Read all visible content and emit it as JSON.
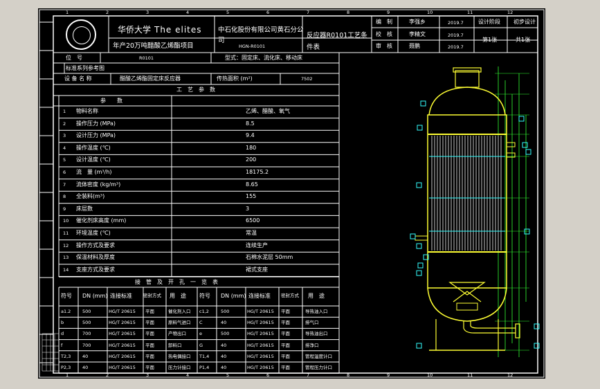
{
  "title_block": {
    "university_cn": "华侨大学",
    "university_en": "The elites",
    "project": "年产20万吨醋酸乙烯酯项目",
    "company_line1": "中石化股份有限公司黄石分公",
    "company_line2": "司",
    "drawing_no": "HGN-R0101",
    "drawing_title_line1": "反应器R0101工艺条",
    "drawing_title_line2": "件表",
    "roles": [
      "编　制",
      "校　核",
      "审　核"
    ],
    "names": [
      "李强乡",
      "李精文",
      "聂鹏"
    ],
    "dates": [
      "2019.7",
      "2019.7",
      "2019.7"
    ],
    "design_stage_label": "设计阶段",
    "design_stage_value": "初步设计",
    "sheet_no": "第1张",
    "sheet_total": "共1张"
  },
  "info_rows": {
    "tag_label": "位　号",
    "tag_value": "R0101",
    "type_label": "型式：固定床、流化床、移动床",
    "std_label": "标准系列参考图",
    "name_label": "设 备 名 称",
    "name_value": "醋酸乙烯酯固定床反应器",
    "area_label": "传热面积 (m²)",
    "area_value": "7502"
  },
  "process_table": {
    "title": "工　艺　参　数",
    "header": "参　　数",
    "rows": [
      {
        "no": "1",
        "param": "物料名称",
        "value": "乙烯、醋酸、氧气"
      },
      {
        "no": "2",
        "param": "操作压力 (MPa)",
        "value": "8.5"
      },
      {
        "no": "3",
        "param": "设计压力 (MPa)",
        "value": "9.4"
      },
      {
        "no": "4",
        "param": "操作温度 (℃)",
        "value": "180"
      },
      {
        "no": "5",
        "param": "设计温度 (℃)",
        "value": "200"
      },
      {
        "no": "6",
        "param": "流　量 (m³/h)",
        "value": "18175.2"
      },
      {
        "no": "7",
        "param": "流体密度 (kg/m³)",
        "value": "8.65"
      },
      {
        "no": "8",
        "param": "全装料(m³)",
        "value": "155"
      },
      {
        "no": "9",
        "param": "床层数",
        "value": "3"
      },
      {
        "no": "10",
        "param": "催化剂床高度 (mm)",
        "value": "6500"
      },
      {
        "no": "11",
        "param": "环境温度 (℃)",
        "value": "常温"
      },
      {
        "no": "12",
        "param": "操作方式及要求",
        "value": "连续生产"
      },
      {
        "no": "13",
        "param": "保温材料及厚度",
        "value": "石棉水泥层 50mm"
      },
      {
        "no": "14",
        "param": "支座方式及要求",
        "value": "裙式支座"
      }
    ]
  },
  "nozzle_table": {
    "title": "接　管　及　开　孔　一　览　表",
    "headers": [
      "符号",
      "DN (mm)",
      "连接标准",
      "密封方式",
      "用　途"
    ],
    "left_rows": [
      {
        "sym": "a1.2",
        "dn": "500",
        "std": "HG/T 20615",
        "seal": "平面",
        "use": "催化剂入口"
      },
      {
        "sym": "b",
        "dn": "500",
        "std": "HG/T 20615",
        "seal": "平面",
        "use": "原料气进口"
      },
      {
        "sym": "d",
        "dn": "700",
        "std": "HG/T 20615",
        "seal": "平面",
        "use": "产物出口"
      },
      {
        "sym": "f",
        "dn": "700",
        "std": "HG/T 20615",
        "seal": "平面",
        "use": "卸料口"
      },
      {
        "sym": "T2,3",
        "dn": "40",
        "std": "HG/T 20615",
        "seal": "平面",
        "use": "热电偶接口"
      },
      {
        "sym": "P2,3",
        "dn": "40",
        "std": "HG/T 20615",
        "seal": "平面",
        "use": "压力计接口"
      }
    ],
    "right_rows": [
      {
        "sym": "c1,2",
        "dn": "500",
        "std": "HG/T 20615",
        "seal": "平面",
        "use": "导热油入口"
      },
      {
        "sym": "C",
        "dn": "40",
        "std": "HG/T 20615",
        "seal": "平面",
        "use": "排气口"
      },
      {
        "sym": "e",
        "dn": "500",
        "std": "HG/T 20615",
        "seal": "平面",
        "use": "导热油出口"
      },
      {
        "sym": "G",
        "dn": "40",
        "std": "HG/T 20615",
        "seal": "平面",
        "use": "排净口"
      },
      {
        "sym": "T1,4",
        "dn": "40",
        "std": "HG/T 20615",
        "seal": "平面",
        "use": "管程温度计口"
      },
      {
        "sym": "P1,4",
        "dn": "40",
        "std": "HG/T 20615",
        "seal": "平面",
        "use": "管程压力计口"
      }
    ]
  },
  "border_numbers": [
    "1",
    "2",
    "3",
    "4",
    "5",
    "6",
    "7",
    "8",
    "9",
    "10",
    "11",
    "12"
  ],
  "colors": {
    "background": "#000000",
    "lines": "#ffffff",
    "shell": "#ffff33",
    "tubes": "#c8c8c8",
    "dimensions": "#33ff33",
    "markers": "#33ffff",
    "window": "#d4d0c8"
  }
}
